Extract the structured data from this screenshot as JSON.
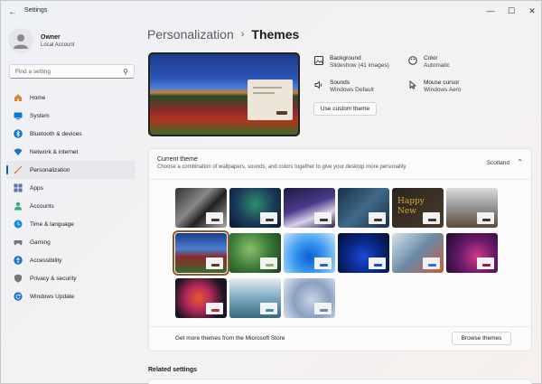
{
  "window": {
    "title": "Settings"
  },
  "profile": {
    "name": "Owner",
    "account": "Local Account"
  },
  "search": {
    "placeholder": "Find a setting"
  },
  "nav": [
    {
      "label": "Home",
      "icon": "home-icon",
      "color": "#d9822b"
    },
    {
      "label": "System",
      "icon": "monitor-icon",
      "color": "#0a78d4"
    },
    {
      "label": "Bluetooth & devices",
      "icon": "bluetooth-icon",
      "color": "#0a78d4"
    },
    {
      "label": "Network & internet",
      "icon": "wifi-icon",
      "color": "#1a73c8"
    },
    {
      "label": "Personalization",
      "icon": "brush-icon",
      "color": "#d66a2b",
      "active": true
    },
    {
      "label": "Apps",
      "icon": "apps-icon",
      "color": "#5c6fa6"
    },
    {
      "label": "Accounts",
      "icon": "person-icon",
      "color": "#2bb07a"
    },
    {
      "label": "Time & language",
      "icon": "globe-clock-icon",
      "color": "#1a8ad4"
    },
    {
      "label": "Gaming",
      "icon": "gamepad-icon",
      "color": "#777777"
    },
    {
      "label": "Accessibility",
      "icon": "accessibility-icon",
      "color": "#1a73c8"
    },
    {
      "label": "Privacy & security",
      "icon": "shield-icon",
      "color": "#777777"
    },
    {
      "label": "Windows Update",
      "icon": "update-icon",
      "color": "#1a73c8"
    }
  ],
  "breadcrumb": {
    "parent": "Personalization",
    "separator": "›",
    "current": "Themes"
  },
  "theme_props": {
    "background": {
      "title": "Background",
      "value": "Slideshow (41 images)"
    },
    "color": {
      "title": "Color",
      "value": "Automatic"
    },
    "sounds": {
      "title": "Sounds",
      "value": "Windows Default"
    },
    "cursor": {
      "title": "Mouse cursor",
      "value": "Windows Aero"
    }
  },
  "custom_button": "Use custom theme",
  "current_theme": {
    "title": "Current theme",
    "subtitle": "Choose a combination of wallpapers, sounds, and colors together to give your desktop more personality",
    "value": "Scotland"
  },
  "themes": [
    {
      "bg": "linear-gradient(135deg,#333 0%,#888 40%,#222 60%,#aaa 100%)",
      "accent": "#3a3a3a"
    },
    {
      "bg": "radial-gradient(circle at 50% 40%,#2f8f6a 0%,#1a3a5a 55%,#0c1830 100%)",
      "accent": "#3a3a3a"
    },
    {
      "bg": "linear-gradient(160deg,#1e1a40 0%,#4a3a8a 45%,#d9d2e8 70%,#2a2450 100%)",
      "accent": "#3a3a3a"
    },
    {
      "bg": "linear-gradient(135deg,#1a2f45 0%,#3e6a8a 50%,#1a3048 100%)",
      "accent": "#3a3a3a"
    },
    {
      "bg": "linear-gradient(135deg,#2a2520 0%,#4a3a2a 100%)",
      "accent": "#3a3a3a",
      "text": "Happy New"
    },
    {
      "bg": "linear-gradient(180deg,#dcdcdc 0%,#9a9a9a 45%,#5a4a3a 100%)",
      "accent": "#3a3a3a"
    },
    {
      "bg": "linear-gradient(180deg,#1d3a8a 0%,#4b7fd0 40%,#8a2a2a 60%,#3b6a2a 100%)",
      "accent": "#5c3a2a",
      "selected": true
    },
    {
      "bg": "radial-gradient(circle at 40% 40%,#8ac06a 0%,#3a7a3a 50%,#1a3a1a 100%)",
      "accent": "#8ab86a"
    },
    {
      "bg": "radial-gradient(circle at 50% 60%,#0a5fd6 0%,#3a9af0 45%,#c8e4fa 100%)",
      "accent": "#1a6ad6"
    },
    {
      "bg": "radial-gradient(circle at 50% 60%,#1a4ad6 0%,#0a2a8a 45%,#050d2a 100%)",
      "accent": "#1a4ad6"
    },
    {
      "bg": "linear-gradient(135deg,#d8e4ec 0%,#6a8aa6 50%,#cc5a3a 100%)",
      "accent": "#3a6ad6"
    },
    {
      "bg": "radial-gradient(circle at 60% 60%,#d63a8a 0%,#6a1a6a 45%,#1a0a2a 100%)",
      "accent": "#8a1a5a"
    },
    {
      "bg": "radial-gradient(circle at 45% 50%,#e85a2a 0%,#b82a5a 35%,#1a1424 75%)",
      "accent": "#c42a3a"
    },
    {
      "bg": "linear-gradient(180deg,#e8eef2 0%,#7aa8c0 50%,#3a6a80 100%)",
      "accent": "#3a8ab0"
    },
    {
      "bg": "radial-gradient(circle at 55% 55%,#c8d4e4 0%,#8aa0c0 50%,#e4eaf2 100%)",
      "accent": "#6a8ab0"
    }
  ],
  "store": {
    "text": "Get more themes from the Microsoft Store",
    "button": "Browse themes"
  },
  "related": {
    "title": "Related settings"
  }
}
